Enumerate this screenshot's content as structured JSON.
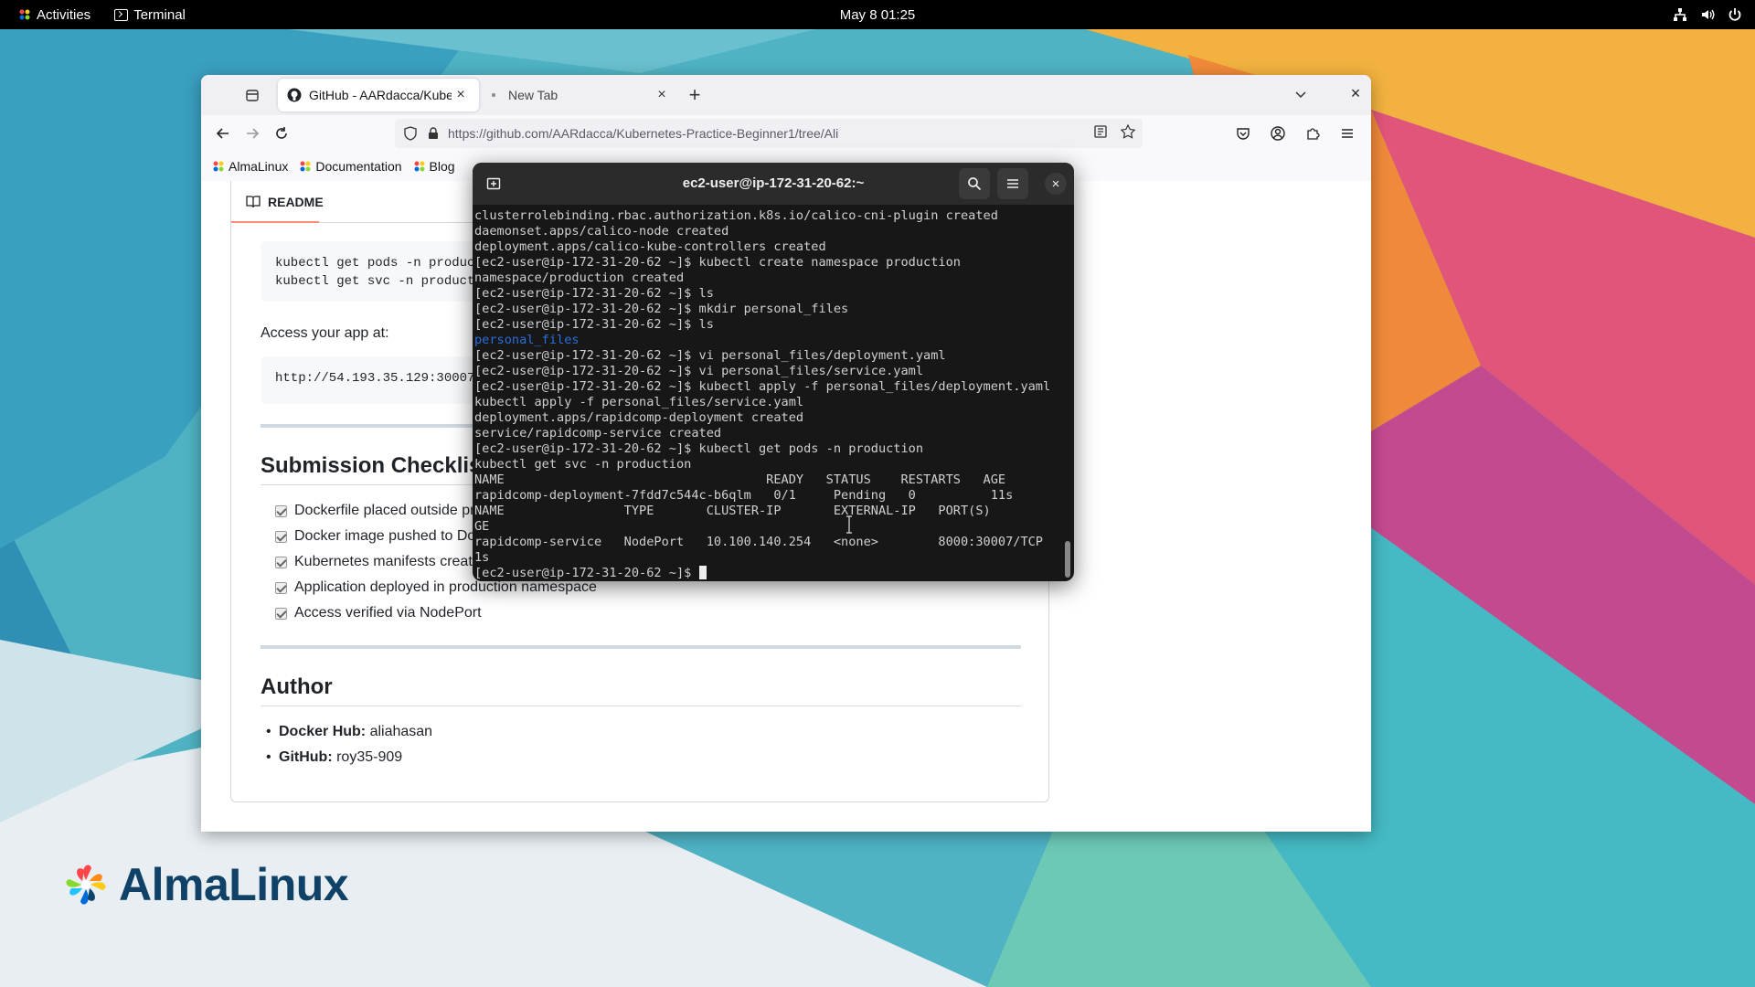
{
  "topbar": {
    "activities": "Activities",
    "app_name": "Terminal",
    "clock": "May 8  01:25"
  },
  "browser": {
    "tabs": [
      {
        "title": "GitHub - AARdacca/Kuber",
        "active": true
      },
      {
        "title": "New Tab",
        "active": false
      }
    ],
    "url": "https://github.com/AARdacca/Kubernetes-Practice-Beginner1/tree/Ali",
    "bookmarks": [
      "AlmaLinux",
      "Documentation",
      "Blog"
    ]
  },
  "readme": {
    "tab_label": "README",
    "code1": "kubectl get pods -n product\nkubectl get svc -n product",
    "access_text": "Access your app at:",
    "code2": "http://54.193.35.129:30007",
    "checklist_title": "Submission Checklis",
    "checklist": [
      "Dockerfile placed outside pr",
      "Docker image pushed to Do",
      "Kubernetes manifests create",
      "Application deployed in production namespace",
      "Access verified via NodePort"
    ],
    "author_title": "Author",
    "author": [
      {
        "key": "Docker Hub:",
        "value": " aliahasan"
      },
      {
        "key": "GitHub:",
        "value": " roy35-909"
      }
    ]
  },
  "terminal": {
    "title": "ec2-user@ip-172-31-20-62:~",
    "lines": [
      {
        "text": "clusterrolebinding.rbac.authorization.k8s.io/calico-cni-plugin created"
      },
      {
        "text": "daemonset.apps/calico-node created"
      },
      {
        "text": "deployment.apps/calico-kube-controllers created"
      },
      {
        "text": "[ec2-user@ip-172-31-20-62 ~]$ kubectl create namespace production"
      },
      {
        "text": "namespace/production created"
      },
      {
        "text": "[ec2-user@ip-172-31-20-62 ~]$ ls"
      },
      {
        "text": "[ec2-user@ip-172-31-20-62 ~]$ mkdir personal_files"
      },
      {
        "text": "[ec2-user@ip-172-31-20-62 ~]$ ls"
      },
      {
        "text": "personal_files",
        "style": "dir"
      },
      {
        "text": "[ec2-user@ip-172-31-20-62 ~]$ vi personal_files/deployment.yaml"
      },
      {
        "text": "[ec2-user@ip-172-31-20-62 ~]$ vi personal_files/service.yaml"
      },
      {
        "text": "[ec2-user@ip-172-31-20-62 ~]$ kubectl apply -f personal_files/deployment.yaml"
      },
      {
        "text": "kubectl apply -f personal_files/service.yaml"
      },
      {
        "text": "deployment.apps/rapidcomp-deployment created"
      },
      {
        "text": "service/rapidcomp-service created"
      },
      {
        "text": "[ec2-user@ip-172-31-20-62 ~]$ kubectl get pods -n production"
      },
      {
        "text": "kubectl get svc -n production"
      },
      {
        "text": "NAME                                   READY   STATUS    RESTARTS   AGE"
      },
      {
        "text": "rapidcomp-deployment-7fdd7c544c-b6qlm   0/1     Pending   0          11s"
      },
      {
        "text": "NAME                TYPE       CLUSTER-IP       EXTERNAL-IP   PORT(S)          A"
      },
      {
        "text": "GE"
      },
      {
        "text": "rapidcomp-service   NodePort   10.100.140.254   <none>        8000:30007/TCP   1"
      },
      {
        "text": "1s"
      }
    ],
    "prompt": "[ec2-user@ip-172-31-20-62 ~]$ "
  },
  "desktop": {
    "logo_text": "AlmaLinux"
  }
}
